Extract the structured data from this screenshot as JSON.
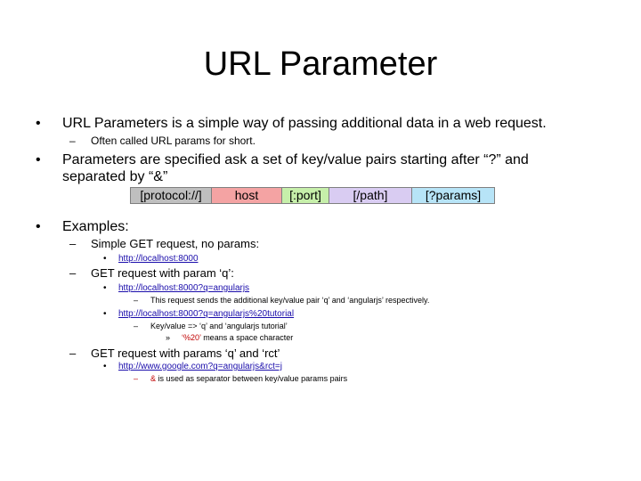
{
  "slide": {
    "title": "URL Parameter",
    "bullets": {
      "b1": {
        "marker": "•",
        "text": "URL Parameters is a simple way of passing additional data in a web request.",
        "sub1": {
          "marker": "–",
          "text": "Often called URL params for short."
        }
      },
      "b2": {
        "marker": "•",
        "text_line1": "Parameters are specified ask a set of key/value pairs starting after “?” and",
        "text_line2": "separated by “&”"
      },
      "b3": {
        "marker": "•",
        "text": "Examples:",
        "ex1": {
          "marker": "–",
          "text": "Simple GET request, no params:",
          "link": {
            "marker": "•",
            "text": "http://localhost:8000"
          }
        },
        "ex2": {
          "marker": "–",
          "text": "GET request with param ‘q’:",
          "link1": {
            "marker": "•",
            "text": "http://localhost:8000?q=angularjs",
            "note": {
              "marker": "–",
              "text": "This request sends the additional key/value pair ‘q’ and ‘angularjs’ respectively."
            }
          },
          "link2": {
            "marker": "•",
            "text": "http://localhost:8000?q=angularjs%20tutorial",
            "note": {
              "marker": "–",
              "text": "Key/value => ‘q’ and ‘angularjs tutorial’",
              "sub": {
                "marker": "»",
                "highlight": "‘%20’",
                "text": " means a space character"
              }
            }
          }
        },
        "ex3": {
          "marker": "–",
          "text": "GET request with params ‘q’ and ‘rct’",
          "link": {
            "marker": "•",
            "text": "http://www.google.com?q=angularjs&rct=j",
            "note": {
              "marker": "–",
              "highlight": "&",
              "text": " is used as separator between key/value params pairs"
            }
          }
        }
      }
    },
    "url_parts": {
      "protocol": {
        "label": "[protocol://]",
        "color": "#bfbfbf"
      },
      "host": {
        "label": "host",
        "color": "#f4a3a3"
      },
      "port": {
        "label": "[:port]",
        "color": "#c6efaa"
      },
      "path": {
        "label": "[/path]",
        "color": "#d9ccf2"
      },
      "params": {
        "label": "[?params]",
        "color": "#b7e4f7"
      }
    },
    "colors": {
      "link": "#1a0dab",
      "highlight_red": "#c00000"
    }
  }
}
